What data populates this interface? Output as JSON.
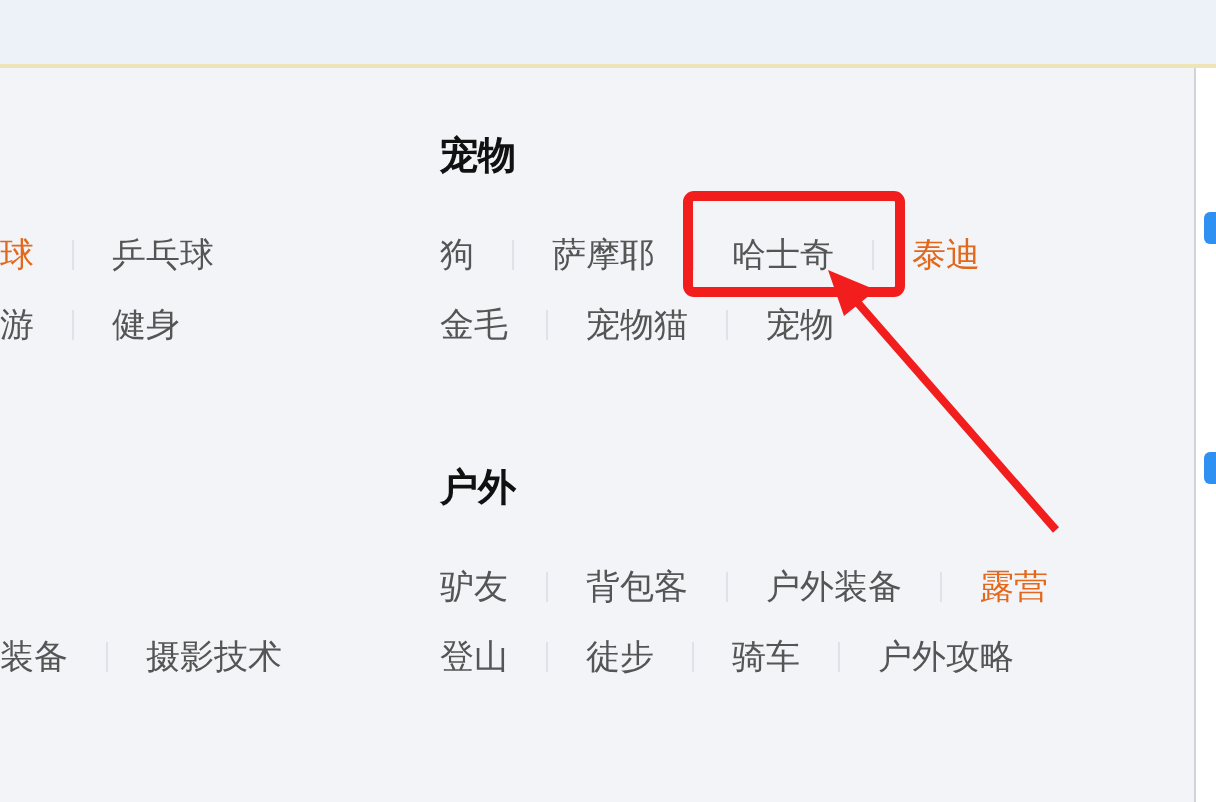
{
  "sections": [
    {
      "left_rows": [
        [
          {
            "text": "球",
            "hot": true
          },
          {
            "text": "乒乓球",
            "hot": false
          }
        ],
        [
          {
            "text": "游",
            "hot": false
          },
          {
            "text": "健身",
            "hot": false
          }
        ]
      ],
      "title": "宠物",
      "rows": [
        [
          {
            "text": "狗",
            "hot": false
          },
          {
            "text": "萨摩耶",
            "hot": false
          },
          {
            "text": "哈士奇",
            "hot": false
          },
          {
            "text": "泰迪",
            "hot": true
          }
        ],
        [
          {
            "text": "金毛",
            "hot": false
          },
          {
            "text": "宠物猫",
            "hot": false
          },
          {
            "text": "宠物",
            "hot": false
          }
        ]
      ]
    },
    {
      "left_rows": [
        [
          {
            "text": "装备",
            "hot": false
          },
          {
            "text": "摄影技术",
            "hot": false
          }
        ]
      ],
      "title": "户外",
      "rows": [
        [
          {
            "text": "驴友",
            "hot": false
          },
          {
            "text": "背包客",
            "hot": false
          },
          {
            "text": "户外装备",
            "hot": false
          },
          {
            "text": "露营",
            "hot": true
          }
        ],
        [
          {
            "text": "登山",
            "hot": false
          },
          {
            "text": "徒步",
            "hot": false
          },
          {
            "text": "骑车",
            "hot": false
          },
          {
            "text": "户外攻略",
            "hot": false
          }
        ]
      ]
    }
  ]
}
